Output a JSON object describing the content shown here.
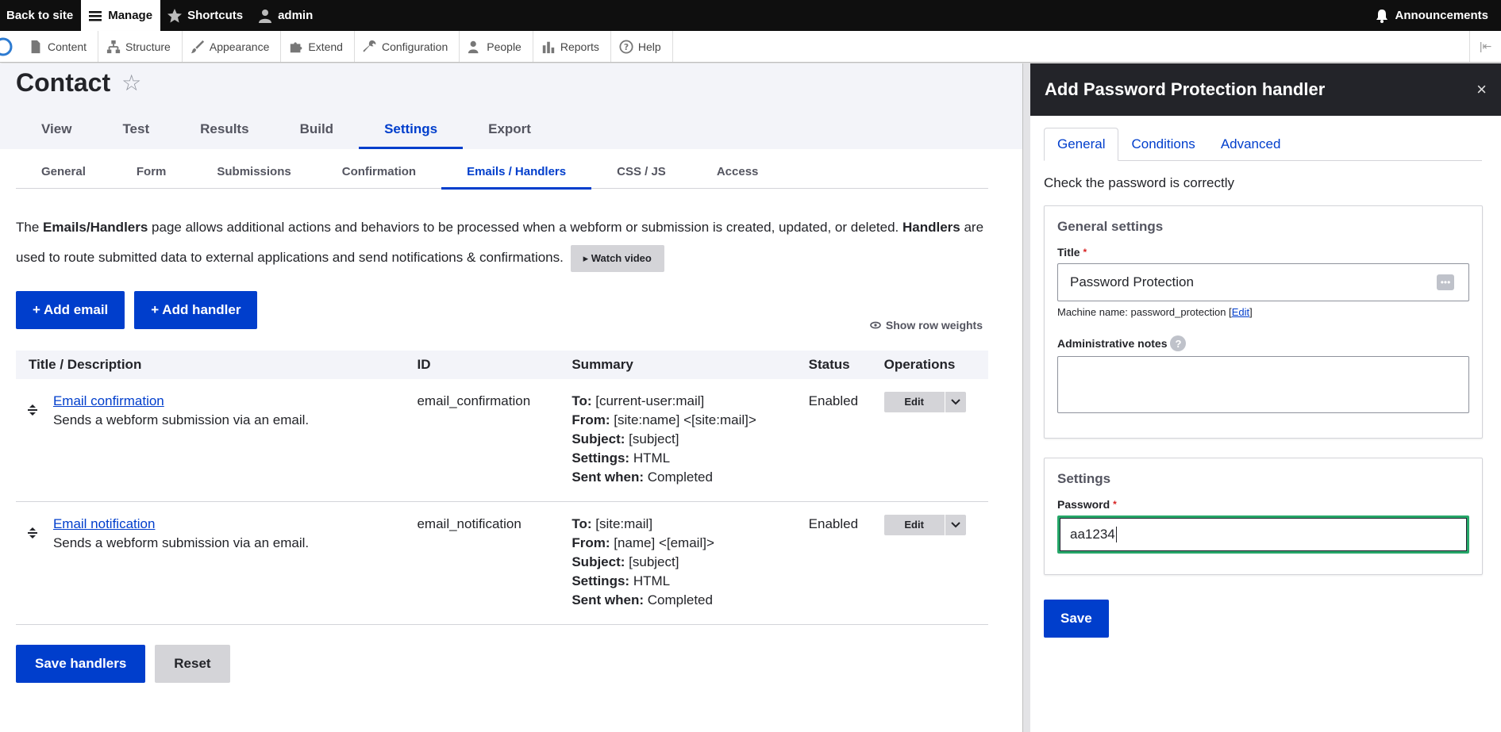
{
  "toolbar": {
    "back": "Back to site",
    "manage": "Manage",
    "shortcuts": "Shortcuts",
    "user": "admin",
    "announcements": "Announcements"
  },
  "tray": {
    "items": [
      "Content",
      "Structure",
      "Appearance",
      "Extend",
      "Configuration",
      "People",
      "Reports",
      "Help"
    ]
  },
  "page": {
    "title": "Contact",
    "primary_tabs": [
      "View",
      "Test",
      "Results",
      "Build",
      "Settings",
      "Export"
    ],
    "primary_active": "Settings",
    "secondary_tabs": [
      "General",
      "Form",
      "Submissions",
      "Confirmation",
      "Emails / Handlers",
      "CSS / JS",
      "Access"
    ],
    "secondary_active": "Emails / Handlers"
  },
  "intro": {
    "t1": "The ",
    "b1": "Emails/Handlers",
    "t2": " page allows additional actions and behaviors to be processed when a webform or submission is created, updated, or deleted. ",
    "b2": "Handlers",
    "t3": " are used to route submitted data to external applications and send notifications & confirmations.",
    "watch": "▸ Watch video"
  },
  "actions": {
    "add_email": "+ Add email",
    "add_handler": "+ Add handler",
    "row_weights": "Show row weights"
  },
  "table": {
    "headers": [
      "Title / Description",
      "ID",
      "Summary",
      "Status",
      "Operations"
    ],
    "rows": [
      {
        "title": "Email confirmation",
        "desc": "Sends a webform submission via an email.",
        "id": "email_confirmation",
        "summary": [
          {
            "k": "To:",
            "v": "[current-user:mail]"
          },
          {
            "k": "From:",
            "v": "[site:name] <[site:mail]>"
          },
          {
            "k": "Subject:",
            "v": "[subject]"
          },
          {
            "k": "Settings:",
            "v": "HTML"
          },
          {
            "k": "Sent when:",
            "v": "Completed"
          }
        ],
        "status": "Enabled",
        "op": "Edit"
      },
      {
        "title": "Email notification",
        "desc": "Sends a webform submission via an email.",
        "id": "email_notification",
        "summary": [
          {
            "k": "To:",
            "v": "[site:mail]"
          },
          {
            "k": "From:",
            "v": "[name] <[email]>"
          },
          {
            "k": "Subject:",
            "v": "[subject]"
          },
          {
            "k": "Settings:",
            "v": "HTML"
          },
          {
            "k": "Sent when:",
            "v": "Completed"
          }
        ],
        "status": "Enabled",
        "op": "Edit"
      }
    ]
  },
  "bottom": {
    "save": "Save handlers",
    "reset": "Reset"
  },
  "dialog": {
    "title": "Add Password Protection handler",
    "close": "×",
    "tabs": [
      "General",
      "Conditions",
      "Advanced"
    ],
    "active_tab": "General",
    "description": "Check the password is correctly",
    "general_legend": "General settings",
    "title_label": "Title",
    "title_value": "Password Protection",
    "machine_prefix": "Machine name: password_protection [",
    "machine_edit": "Edit",
    "machine_suffix": "]",
    "notes_label": "Administrative notes",
    "settings_legend": "Settings",
    "password_label": "Password",
    "password_value": "aa1234",
    "save": "Save"
  },
  "colors": {
    "primary": "#003ecc",
    "focus": "#26a769",
    "required": "#d72222"
  }
}
